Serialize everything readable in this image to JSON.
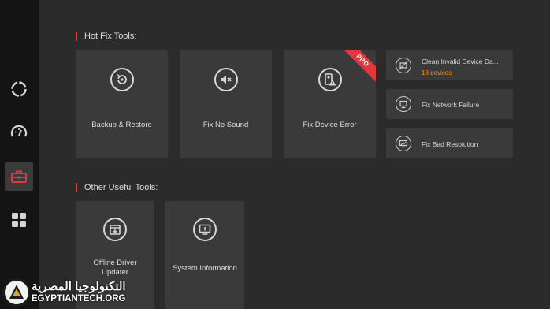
{
  "sidebar": {
    "items": [
      {
        "name": "refresh-icon"
      },
      {
        "name": "speedometer-icon"
      },
      {
        "name": "toolbox-icon",
        "active": true
      },
      {
        "name": "apps-grid-icon"
      }
    ]
  },
  "hot_fix": {
    "title": "Hot Fix Tools:",
    "cards": [
      {
        "label": "Backup & Restore",
        "icon": "backup-restore-icon"
      },
      {
        "label": "Fix No Sound",
        "icon": "mute-speaker-icon"
      },
      {
        "label": "Fix Device Error",
        "icon": "device-warning-icon",
        "badge": "PRO"
      }
    ],
    "side_cards": [
      {
        "title": "Clean Invalid Device Da...",
        "subtitle": "18 devices",
        "icon": "invalid-device-icon"
      },
      {
        "title": "Fix Network Failure",
        "icon": "network-failure-icon"
      },
      {
        "title": "Fix Bad Resolution",
        "icon": "bad-resolution-icon"
      }
    ]
  },
  "other": {
    "title": "Other Useful Tools:",
    "cards": [
      {
        "label": "Offline Driver Updater",
        "icon": "offline-driver-icon"
      },
      {
        "label": "System Information",
        "icon": "system-info-icon"
      }
    ]
  },
  "watermark": {
    "arabic": "التكنولوجيا المصرية",
    "url": "EGYPTIANTECH.ORG"
  },
  "colors": {
    "accent": "#e0383e",
    "orange": "#f0932b",
    "sidebar_bg": "#141414",
    "main_bg": "#2b2b2b",
    "card_bg": "#3a3a3a"
  }
}
